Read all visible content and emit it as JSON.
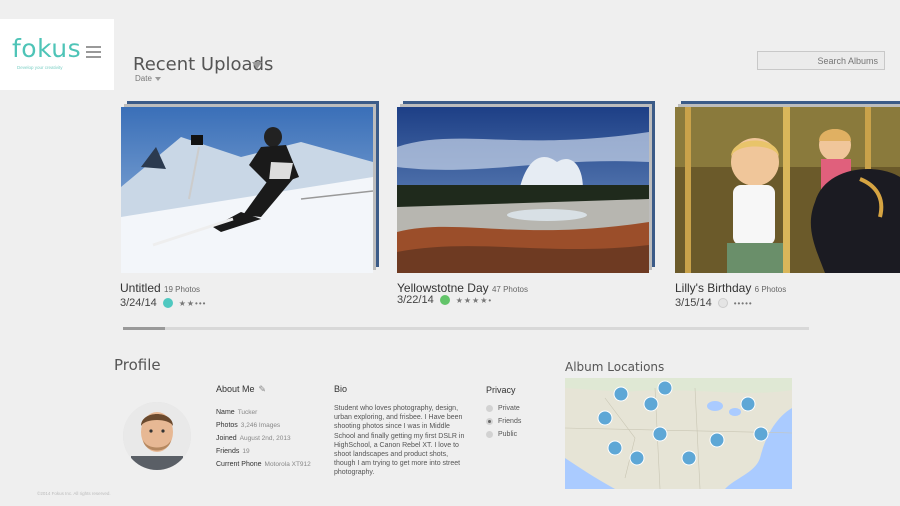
{
  "app": {
    "logo": "fokus",
    "tagline": "Develop your creativity",
    "copyright": "©2014 Fokus Inc. All rights reserved."
  },
  "header": {
    "title": "Recent Uploads",
    "sort_label": "Date",
    "search_placeholder": "Search Albums"
  },
  "albums": [
    {
      "title": "Untitled",
      "count": "19 Photos",
      "date": "3/24/14",
      "dot_color": "#4fc8c0",
      "rating": 2,
      "stars": "★★•••"
    },
    {
      "title": "Yellowstotne Day",
      "count": "47 Photos",
      "date": "3/22/14",
      "dot_color": "#63c46a",
      "rating": 4,
      "stars": "★★★★•"
    },
    {
      "title": "Lilly's Birthday",
      "count": "6 Photos",
      "date": "3/15/14",
      "dot_color": "#e4e4e4",
      "rating": 0,
      "stars": "•••••"
    }
  ],
  "scroll": {
    "position": 0.06
  },
  "profile": {
    "title": "Profile",
    "about_heading": "About Me",
    "fields": [
      {
        "label": "Name",
        "value": "Tucker"
      },
      {
        "label": "Photos",
        "value": "3,246 Images"
      },
      {
        "label": "Joined",
        "value": "August 2nd, 2013"
      },
      {
        "label": "Friends",
        "value": "19"
      },
      {
        "label": "Current Phone",
        "value": "Motorola XT912"
      }
    ],
    "bio_heading": "Bio",
    "bio": "Student who loves photography, design, urban exploring, and frisbee. I Have been shooting photos since I was in Middle School and finally getting my first DSLR in HighSchool, a Canon Rebel XT. I love to shoot landscapes and product shots, though I am trying to get more into street photography.",
    "privacy_heading": "Privacy",
    "privacy_options": [
      "Private",
      "Friends",
      "Public"
    ],
    "privacy_selected": "Friends"
  },
  "map": {
    "title": "Album Locations",
    "pin_color": "#5ea7d6"
  }
}
